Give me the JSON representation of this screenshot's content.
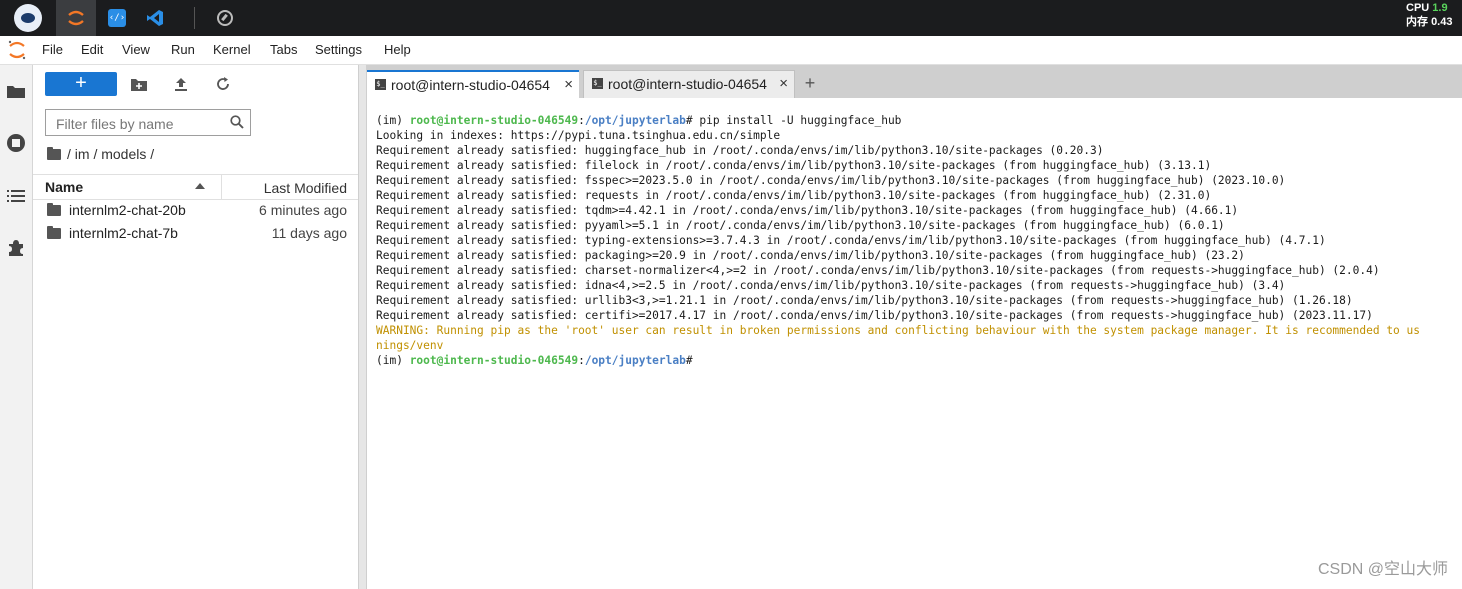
{
  "topbar": {
    "resources": {
      "cpu_label": "CPU",
      "cpu_value": "1.9",
      "mem_label": "内存",
      "mem_value": "0.43"
    }
  },
  "menubar": {
    "items": [
      "File",
      "Edit",
      "View",
      "Run",
      "Kernel",
      "Tabs",
      "Settings",
      "Help"
    ]
  },
  "filebrowser": {
    "new_button": "+",
    "search_placeholder": "Filter files by name",
    "breadcrumb": "/ im / models /",
    "columns": {
      "name": "Name",
      "modified": "Last Modified"
    },
    "files": [
      {
        "name": "internlm2-chat-20b",
        "modified": "6 minutes ago"
      },
      {
        "name": "internlm2-chat-7b",
        "modified": "11 days ago"
      }
    ]
  },
  "tabs": [
    {
      "label": "root@intern-studio-04654",
      "close": "×",
      "icon": "$_"
    },
    {
      "label": "root@intern-studio-04654",
      "close": "×",
      "icon": "$_"
    }
  ],
  "add_tab": "+",
  "terminal": {
    "prompt": {
      "env": "(im) ",
      "user": "root@intern-studio-046549",
      "sep": ":",
      "path": "/opt/jupyterlab",
      "end": "# "
    },
    "command": "pip install -U huggingface_hub",
    "output": [
      "Looking in indexes: https://pypi.tuna.tsinghua.edu.cn/simple",
      "Requirement already satisfied: huggingface_hub in /root/.conda/envs/im/lib/python3.10/site-packages (0.20.3)",
      "Requirement already satisfied: filelock in /root/.conda/envs/im/lib/python3.10/site-packages (from huggingface_hub) (3.13.1)",
      "Requirement already satisfied: fsspec>=2023.5.0 in /root/.conda/envs/im/lib/python3.10/site-packages (from huggingface_hub) (2023.10.0)",
      "Requirement already satisfied: requests in /root/.conda/envs/im/lib/python3.10/site-packages (from huggingface_hub) (2.31.0)",
      "Requirement already satisfied: tqdm>=4.42.1 in /root/.conda/envs/im/lib/python3.10/site-packages (from huggingface_hub) (4.66.1)",
      "Requirement already satisfied: pyyaml>=5.1 in /root/.conda/envs/im/lib/python3.10/site-packages (from huggingface_hub) (6.0.1)",
      "Requirement already satisfied: typing-extensions>=3.7.4.3 in /root/.conda/envs/im/lib/python3.10/site-packages (from huggingface_hub) (4.7.1)",
      "Requirement already satisfied: packaging>=20.9 in /root/.conda/envs/im/lib/python3.10/site-packages (from huggingface_hub) (23.2)",
      "Requirement already satisfied: charset-normalizer<4,>=2 in /root/.conda/envs/im/lib/python3.10/site-packages (from requests->huggingface_hub) (2.0.4)",
      "Requirement already satisfied: idna<4,>=2.5 in /root/.conda/envs/im/lib/python3.10/site-packages (from requests->huggingface_hub) (3.4)",
      "Requirement already satisfied: urllib3<3,>=1.21.1 in /root/.conda/envs/im/lib/python3.10/site-packages (from requests->huggingface_hub) (1.26.18)",
      "Requirement already satisfied: certifi>=2017.4.17 in /root/.conda/envs/im/lib/python3.10/site-packages (from requests->huggingface_hub) (2023.11.17)"
    ],
    "warning": [
      "WARNING: Running pip as the 'root' user can result in broken permissions and conflicting behaviour with the system package manager. It is recommended to us",
      "nings/venv"
    ]
  },
  "watermark": "CSDN @空山大师"
}
